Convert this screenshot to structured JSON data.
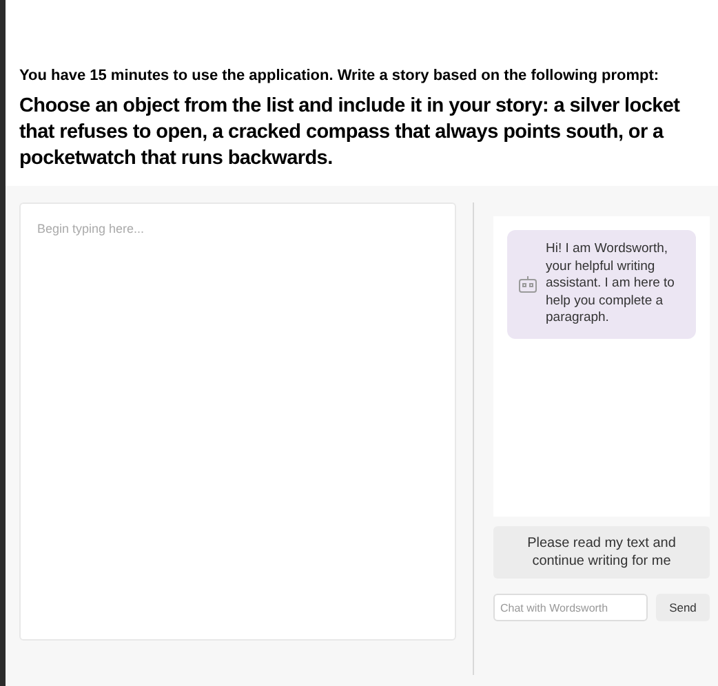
{
  "instruction": "You have 15 minutes to use the application. Write a story based on the following prompt:",
  "prompt": "Choose an object from the list and include it in your story: a silver locket that refuses to open, a cracked compass that always points south, or a pocketwatch that runs backwards.",
  "editor": {
    "placeholder": "Begin typing here..."
  },
  "chat": {
    "messages": [
      {
        "kind": "assistant",
        "text": "Hi! I am Wordsworth, your helpful writing assistant. I am here to help you complete a paragraph."
      }
    ],
    "suggestion": "Please read my text and continue writing for me",
    "input": {
      "placeholder": "Chat with Wordsworth"
    },
    "send": "Send"
  }
}
